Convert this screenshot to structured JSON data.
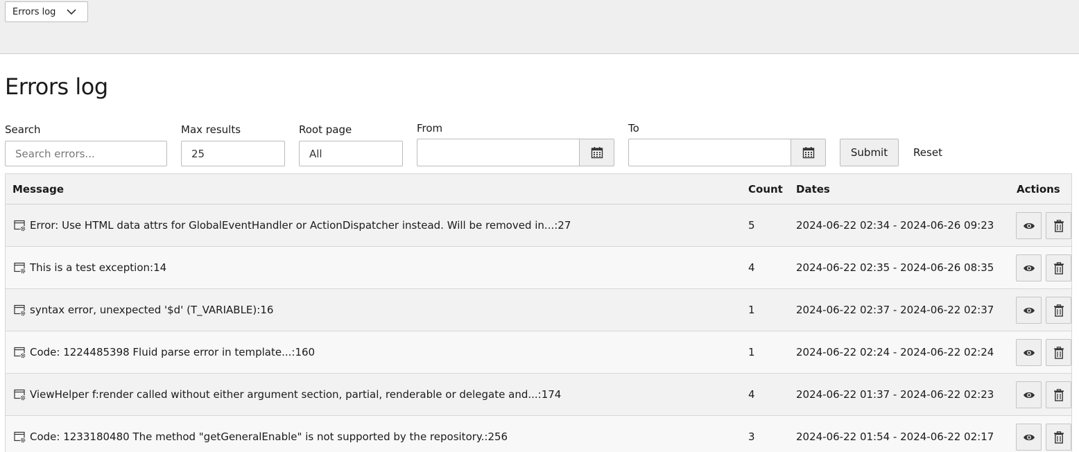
{
  "module_menu": {
    "label": "Errors log"
  },
  "page": {
    "title": "Errors log"
  },
  "filters": {
    "search": {
      "label": "Search",
      "placeholder": "Search errors..."
    },
    "max_results": {
      "label": "Max results",
      "value": "25"
    },
    "root_page": {
      "label": "Root page",
      "value": "All"
    },
    "from": {
      "label": "From",
      "value": ""
    },
    "to": {
      "label": "To",
      "value": ""
    },
    "submit_label": "Submit",
    "reset_label": "Reset"
  },
  "table": {
    "columns": [
      "Message",
      "Count",
      "Dates",
      "Actions"
    ],
    "rows": [
      {
        "message": "Error: Use HTML data attrs for GlobalEventHandler or ActionDispatcher instead. Will be removed in...:27",
        "count": "5",
        "dates": "2024-06-22 02:34 - 2024-06-26 09:23"
      },
      {
        "message": "This is a test exception:14",
        "count": "4",
        "dates": "2024-06-22 02:35 - 2024-06-26 08:35"
      },
      {
        "message": "syntax error, unexpected '$d' (T_VARIABLE):16",
        "count": "1",
        "dates": "2024-06-22 02:37 - 2024-06-22 02:37"
      },
      {
        "message": "Code: 1224485398 Fluid parse error in template...:160",
        "count": "1",
        "dates": "2024-06-22 02:24 - 2024-06-22 02:24"
      },
      {
        "message": "ViewHelper f:render called without either argument section, partial, renderable or delegate and...:174",
        "count": "4",
        "dates": "2024-06-22 01:37 - 2024-06-22 02:23"
      },
      {
        "message": "Code: 1233180480 The method \"getGeneralEnable\" is not supported by the repository.:256",
        "count": "3",
        "dates": "2024-06-22 01:54 - 2024-06-22 02:17"
      }
    ]
  },
  "icons": {
    "module_dropdown": "chevron-down-icon",
    "date_picker": "calendar-icon",
    "row": "window-gear-icon",
    "view": "eye-icon",
    "delete": "trash-icon"
  }
}
